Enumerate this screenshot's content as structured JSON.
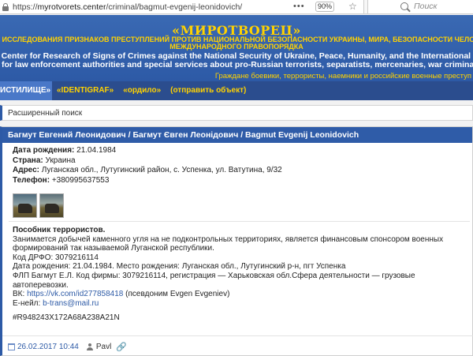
{
  "browser": {
    "url_prefix": "https://",
    "url_host": "myrotvorets.center",
    "url_path": "/criminal/bagmut-evgenij-leonidovich/",
    "menu_dots": "•••",
    "zoom": "90%",
    "search_placeholder": "Поиск"
  },
  "header": {
    "site_title": "«МИРОТВОРЕЦ»",
    "ru_line1": "Р ИССЛЕДОВАНИЯ ПРИЗНАКОВ ПРЕСТУПЛЕНИЙ ПРОТИВ НАЦИОНАЛЬНОЙ БЕЗОПАСНОСТИ УКРАИНЫ, МИРА, БЕЗОПАСНОСТИ ЧЕЛОВЕЧ",
    "ru_line2": "МЕЖДУНАРОДНОГО ПРАВОПОРЯДКА",
    "en_line1": "Center for Research of Signs of Crimes against the National Security of Ukraine, Peace, Humanity, and the International Law",
    "en_line2": "for law enforcement authorities and special services about pro-Russian terrorists, separatists, mercenaries, war criminals, and",
    "slogan": "Граждане боевики, террористы, наемники и российские военные преступ"
  },
  "nav": {
    "items": [
      {
        "label": "ИСТИЛИЩЕ»"
      },
      {
        "label": "«IDENTIGRAF»"
      },
      {
        "label": "«ордило»"
      },
      {
        "label": "(отправить объект)"
      }
    ]
  },
  "search_panel": {
    "label": "Расширенный поиск"
  },
  "card": {
    "title": "Багмут Евгений Леонидович / Багмут Євген Леонідович / Bagmut Evgenij Leonidovich",
    "fields": [
      {
        "label": "Дата рождения:",
        "value": "21.04.1984"
      },
      {
        "label": "Страна:",
        "value": "Украина"
      },
      {
        "label": "Адрес:",
        "value": "Луганская обл., Лутугинский район, с. Успенка, ул. Ватутина, 9/32"
      },
      {
        "label": "Телефон:",
        "value": "+380995637553"
      }
    ],
    "description": {
      "heading": "Пособник террористов.",
      "line1": "Занимается добычей каменного угля на не подконтрольных территориях, является финансовым спонсором военных",
      "line2": "формирований так называемой Луганской республики.",
      "line3": "Код ДРФО: 3079216114",
      "line4": "Дата рождения: 21.04.1984. Место рождения: Луганская обл., Лутугинский р-н, пгт Успенка",
      "line5": "ФЛП Багмут Е.Л. Код фирмы: 3079216114, регистрация — Харьковская обл.Сфера деятельности — грузовые автоперевозки.",
      "vk_label": "ВК: ",
      "vk_link": "https://vk.com/id277858418",
      "vk_note": " (псевдоним Evgen Evgeniev)",
      "email_label": "E-нейл: ",
      "email_link": "b-trans@mail.ru",
      "code": "#R948243X172A68A238A21N"
    },
    "footer": {
      "date": "26.02.2017 10:44",
      "author": "Pavl"
    }
  }
}
